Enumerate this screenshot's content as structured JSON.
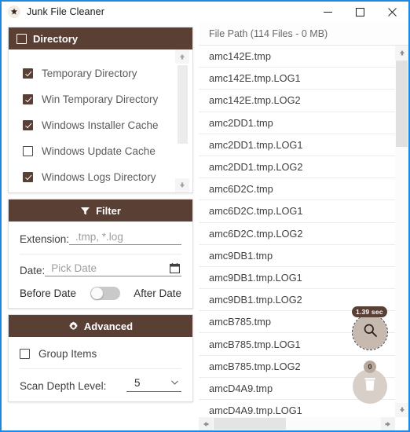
{
  "titlebar": {
    "icon": "broom-icon",
    "title": "Junk File Cleaner",
    "minimize_label": "Minimize",
    "maximize_label": "Maximize",
    "close_label": "Close"
  },
  "directory": {
    "header": "Directory",
    "header_icon": "checkbox-icon",
    "items": [
      {
        "label": "Temporary Directory",
        "checked": true
      },
      {
        "label": "Win Temporary Directory",
        "checked": true
      },
      {
        "label": "Windows Installer Cache",
        "checked": true
      },
      {
        "label": "Windows Update Cache",
        "checked": false
      },
      {
        "label": "Windows Logs Directory",
        "checked": true
      }
    ]
  },
  "filter": {
    "header": "Filter",
    "header_icon": "funnel-icon",
    "extension_label": "Extension:",
    "extension_value": ".tmp, *.log",
    "date_label": "Date:",
    "date_placeholder": "Pick Date",
    "calendar_icon": "calendar-icon",
    "before_date_label": "Before Date",
    "after_date_label": "After Date",
    "toggle_state": "before"
  },
  "advanced": {
    "header": "Advanced",
    "header_icon": "gear-icon",
    "group_items_label": "Group Items",
    "group_items_checked": false,
    "scan_depth_label": "Scan Depth Level:",
    "scan_depth_value": "5"
  },
  "filelist": {
    "header": "File Path (114 Files - 0 MB)",
    "rows": [
      "amc142E.tmp",
      "amc142E.tmp.LOG1",
      "amc142E.tmp.LOG2",
      "amc2DD1.tmp",
      "amc2DD1.tmp.LOG1",
      "amc2DD1.tmp.LOG2",
      "amc6D2C.tmp",
      "amc6D2C.tmp.LOG1",
      "amc6D2C.tmp.LOG2",
      "amc9DB1.tmp",
      "amc9DB1.tmp.LOG1",
      "amc9DB1.tmp.LOG2",
      "amcB785.tmp",
      "amcB785.tmp.LOG1",
      "amcB785.tmp.LOG2",
      "amcD4A9.tmp",
      "amcD4A9.tmp.LOG1"
    ]
  },
  "fabs": {
    "scan_icon": "magnifier-icon",
    "scan_time_badge": "1.39 sec",
    "delete_icon": "trash-icon",
    "delete_count_badge": "0"
  },
  "scroll": {
    "up_arrow": "arrow-up-icon",
    "down_arrow": "arrow-down-icon",
    "left_arrow": "arrow-left-icon",
    "right_arrow": "arrow-right-icon"
  },
  "colors": {
    "accent_brown": "#5a3f35",
    "window_border_blue": "#1e88e5",
    "fab_search_bg": "#c6b9b0",
    "fab_trash_bg": "#d8cfc9"
  }
}
